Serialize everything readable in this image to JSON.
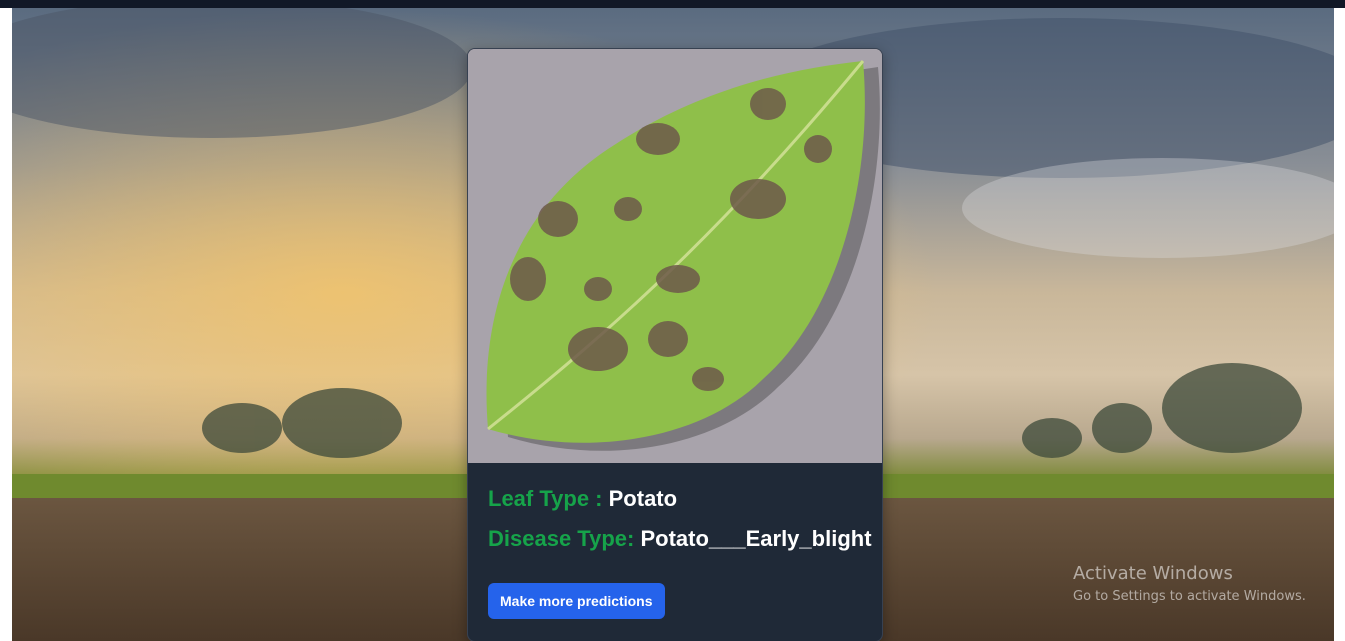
{
  "result": {
    "leaf_label": "Leaf Type : ",
    "leaf_value": "Potato",
    "disease_label": "Disease Type: ",
    "disease_value": "Potato___Early_blight"
  },
  "actions": {
    "more_predictions_label": "Make more predictions"
  },
  "watermark": {
    "title": "Activate Windows",
    "subtitle": "Go to Settings to activate Windows."
  },
  "colors": {
    "label_green": "#16a34a",
    "card_bg": "#1f2937",
    "button_blue": "#2563eb"
  }
}
